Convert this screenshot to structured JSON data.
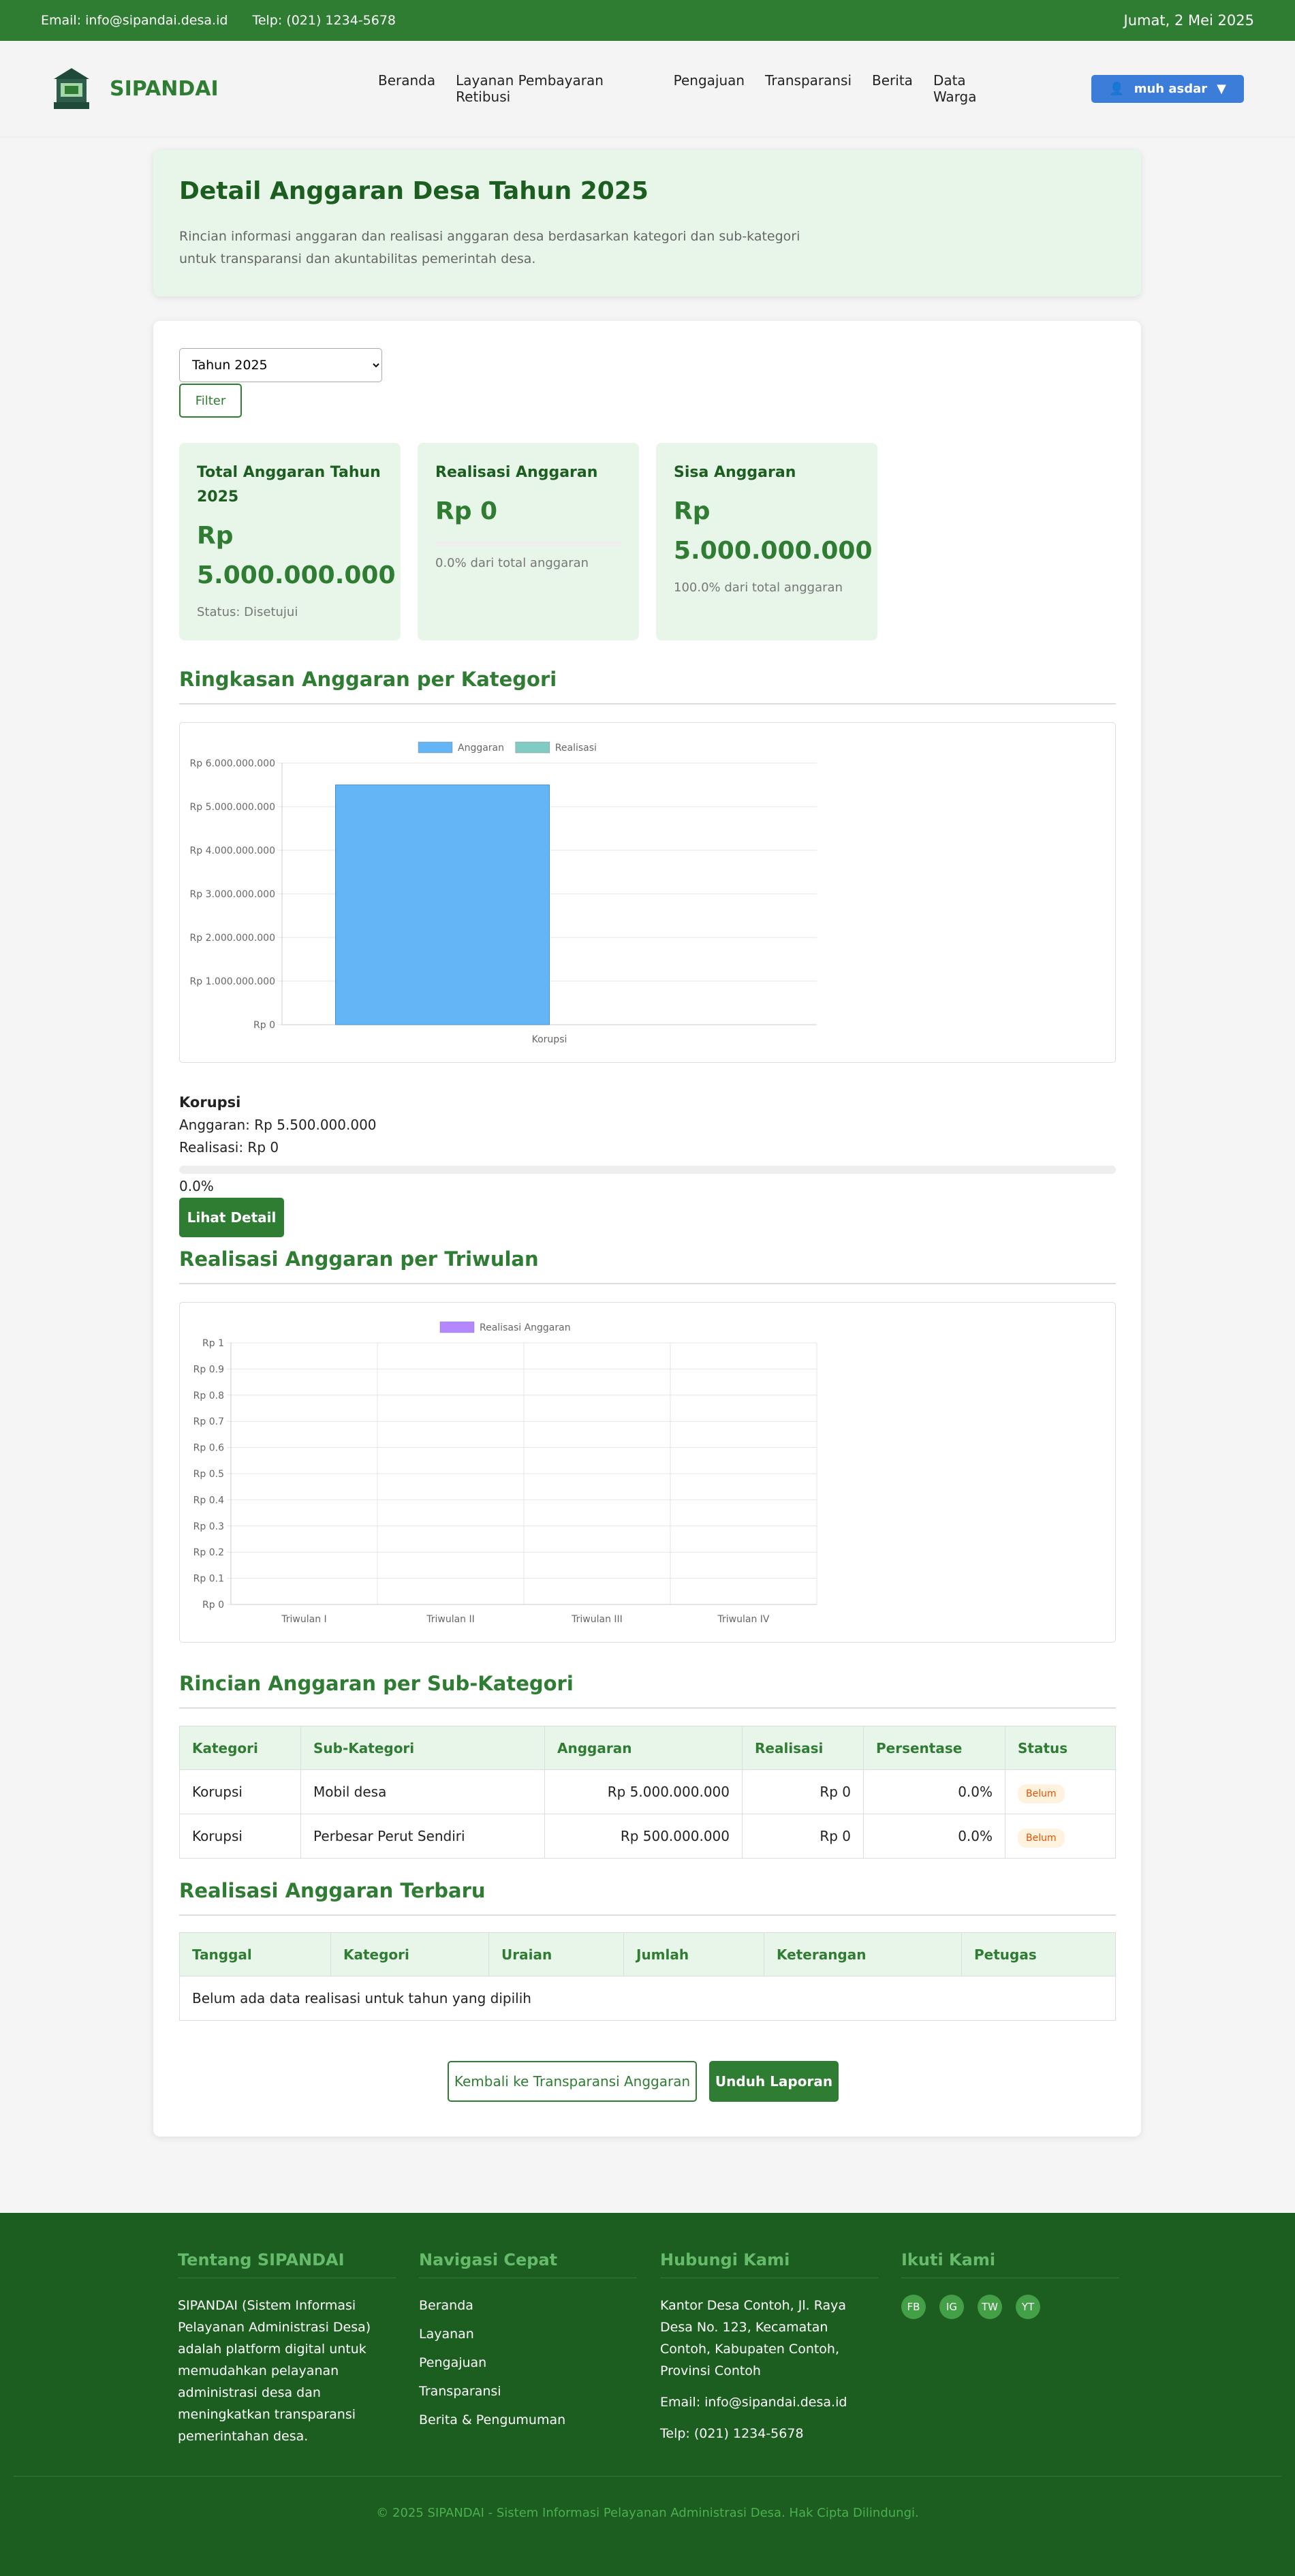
{
  "topbar": {
    "email": "Email: info@sipandai.desa.id",
    "phone": "Telp: (021) 1234-5678",
    "date": "Jumat, 2 Mei 2025"
  },
  "brand": {
    "name": "SIPANDAI"
  },
  "nav": {
    "items": [
      "Beranda",
      "Layanan Pembayaran Retibusi",
      "Pengajuan",
      "Transparansi",
      "Berita",
      "Data Warga"
    ],
    "user": "muh asdar"
  },
  "hero": {
    "title": "Detail Anggaran Desa Tahun 2025",
    "description": "Rincian informasi anggaran dan realisasi anggaran desa berdasarkan kategori dan sub-kategori untuk transparansi dan akuntabilitas pemerintah desa."
  },
  "filter": {
    "year_selected": "Tahun 2025",
    "button": "Filter"
  },
  "stats": {
    "total": {
      "title": "Total Anggaran Tahun 2025",
      "value": "Rp 5.000.000.000",
      "sub": "Status: Disetujui"
    },
    "realisasi": {
      "title": "Realisasi Anggaran",
      "value": "Rp 0",
      "sub": "0.0% dari total anggaran",
      "fraction": 0
    },
    "sisa": {
      "title": "Sisa Anggaran",
      "value": "Rp 5.000.000.000",
      "sub": "100.0% dari total anggaran"
    }
  },
  "sections": {
    "kategori": "Ringkasan Anggaran per Kategori",
    "triwulan": "Realisasi Anggaran per Triwulan",
    "subkategori": "Rincian Anggaran per Sub-Kategori",
    "terbaru": "Realisasi Anggaran Terbaru"
  },
  "chart_data": [
    {
      "type": "bar",
      "categories": [
        "Korupsi"
      ],
      "series": [
        {
          "name": "Anggaran",
          "values": [
            5500000000
          ],
          "color": "#64b5f6"
        },
        {
          "name": "Realisasi",
          "values": [
            0
          ],
          "color": "#80cbc4"
        }
      ],
      "ylim": [
        0,
        6000000000
      ],
      "yticks": [
        "Rp 0",
        "Rp 1.000.000.000",
        "Rp 2.000.000.000",
        "Rp 3.000.000.000",
        "Rp 4.000.000.000",
        "Rp 5.000.000.000",
        "Rp 6.000.000.000"
      ],
      "legend": "top",
      "grid": true
    },
    {
      "type": "bar",
      "categories": [
        "Triwulan I",
        "Triwulan II",
        "Triwulan III",
        "Triwulan IV"
      ],
      "series": [
        {
          "name": "Realisasi Anggaran",
          "values": [
            0,
            0,
            0,
            0
          ],
          "color": "#b388ff"
        }
      ],
      "ylim": [
        0,
        1
      ],
      "yticks": [
        "Rp 0",
        "Rp 0.1",
        "Rp 0.2",
        "Rp 0.3",
        "Rp 0.4",
        "Rp 0.5",
        "Rp 0.6",
        "Rp 0.7",
        "Rp 0.8",
        "Rp 0.9",
        "Rp 1"
      ],
      "legend": "top",
      "grid": true
    }
  ],
  "category_info": {
    "name": "Korupsi",
    "anggaran": "Anggaran: Rp 5.500.000.000",
    "realisasi": "Realisasi: Rp 0",
    "percent": "0.0%",
    "fraction": 0,
    "button": "Lihat Detail"
  },
  "subcat_table": {
    "headers": [
      "Kategori",
      "Sub-Kategori",
      "Anggaran",
      "Realisasi",
      "Persentase",
      "Status"
    ],
    "rows": [
      [
        "Korupsi",
        "Mobil desa",
        "Rp 5.000.000.000",
        "Rp 0",
        "0.0%",
        "Belum"
      ],
      [
        "Korupsi",
        "Perbesar Perut Sendiri",
        "Rp 500.000.000",
        "Rp 0",
        "0.0%",
        "Belum"
      ]
    ]
  },
  "recent_table": {
    "headers": [
      "Tanggal",
      "Kategori",
      "Uraian",
      "Jumlah",
      "Keterangan",
      "Petugas"
    ],
    "empty": "Belum ada data realisasi untuk tahun yang dipilih"
  },
  "actions": {
    "back": "Kembali ke Transparansi Anggaran",
    "download": "Unduh Laporan"
  },
  "footer": {
    "about_title": "Tentang SIPANDAI",
    "about_text": "SIPANDAI (Sistem Informasi Pelayanan Administrasi Desa) adalah platform digital untuk memudahkan pelayanan administrasi desa dan meningkatkan transparansi pemerintahan desa.",
    "nav_title": "Navigasi Cepat",
    "nav_items": [
      "Beranda",
      "Layanan",
      "Pengajuan",
      "Transparansi",
      "Berita & Pengumuman"
    ],
    "contact_title": "Hubungi Kami",
    "address": "Kantor Desa Contoh, Jl. Raya Desa No. 123, Kecamatan Contoh, Kabupaten Contoh, Provinsi Contoh",
    "email": "Email: info@sipandai.desa.id",
    "phone": "Telp: (021) 1234-5678",
    "follow_title": "Ikuti Kami",
    "social": [
      "FB",
      "IG",
      "TW",
      "YT"
    ],
    "copyright": "© 2025 SIPANDAI - Sistem Informasi Pelayanan Administrasi Desa. Hak Cipta Dilindungi."
  }
}
